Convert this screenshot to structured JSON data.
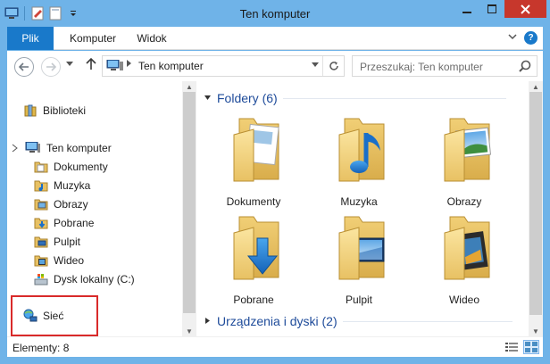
{
  "window": {
    "title": "Ten komputer"
  },
  "ribbon": {
    "tabs": [
      {
        "label": "Plik"
      },
      {
        "label": "Komputer"
      },
      {
        "label": "Widok"
      }
    ]
  },
  "address": {
    "crumb": "Ten komputer",
    "search_placeholder": "Przeszukaj: Ten komputer"
  },
  "nav": {
    "items": [
      {
        "label": "Biblioteki",
        "icon": "libraries-icon"
      },
      {
        "label": "Ten komputer",
        "icon": "computer-icon"
      },
      {
        "label": "Dokumenty",
        "icon": "documents-icon"
      },
      {
        "label": "Muzyka",
        "icon": "music-icon"
      },
      {
        "label": "Obrazy",
        "icon": "pictures-icon"
      },
      {
        "label": "Pobrane",
        "icon": "downloads-icon"
      },
      {
        "label": "Pulpit",
        "icon": "desktop-icon"
      },
      {
        "label": "Wideo",
        "icon": "video-icon"
      },
      {
        "label": "Dysk lokalny (C:)",
        "icon": "drive-icon"
      },
      {
        "label": "Sieć",
        "icon": "network-icon"
      }
    ]
  },
  "content": {
    "groups": [
      {
        "title": "Foldery (6)"
      },
      {
        "title": "Urządzenia i dyski (2)"
      }
    ],
    "folders": [
      {
        "label": "Dokumenty",
        "icon": "documents-folder-icon"
      },
      {
        "label": "Muzyka",
        "icon": "music-folder-icon"
      },
      {
        "label": "Obrazy",
        "icon": "pictures-folder-icon"
      },
      {
        "label": "Pobrane",
        "icon": "downloads-folder-icon"
      },
      {
        "label": "Pulpit",
        "icon": "desktop-folder-icon"
      },
      {
        "label": "Wideo",
        "icon": "video-folder-icon"
      }
    ]
  },
  "status": {
    "count": "Elementy: 8"
  },
  "colors": {
    "titlebar": "#6fb3e8",
    "file_tab": "#1979ca",
    "close_button": "#c7372c",
    "group_title": "#1e4b9a",
    "highlight_box": "#d92a2a"
  }
}
